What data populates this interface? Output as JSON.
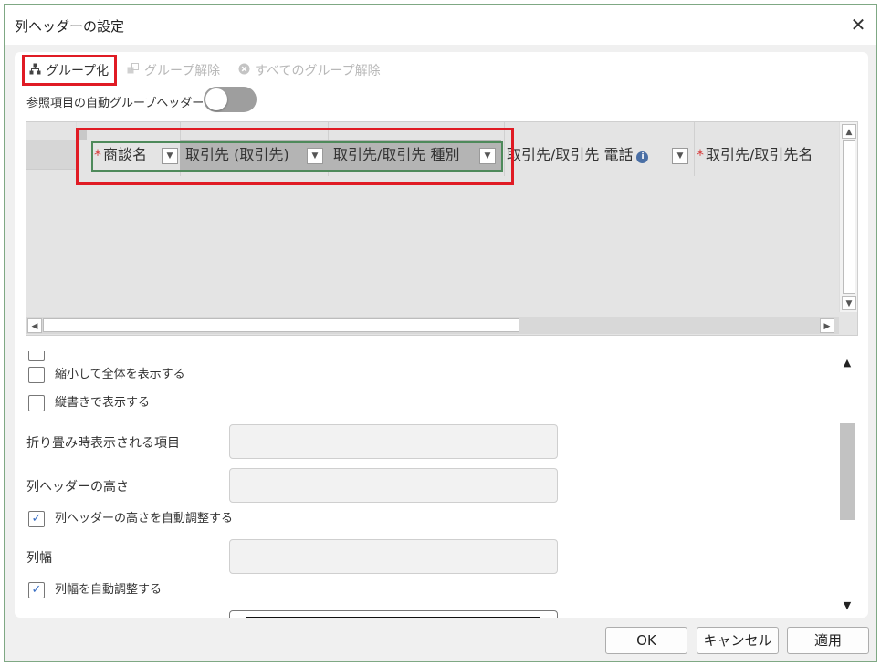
{
  "dialog": {
    "title": "列ヘッダーの設定",
    "close_glyph": "✕"
  },
  "toolbar": {
    "group_label": "グループ化",
    "ungroup_label": "グループ解除",
    "ungroup_all_label": "すべてのグループ解除",
    "group_icon": "hierarchy-icon",
    "ungroup_icon": "ungroup-icon",
    "ungroup_all_icon": "x-circle-icon"
  },
  "auto_group": {
    "label": "参照項目の自動グループヘッダー",
    "enabled": false
  },
  "grid": {
    "columns": [
      {
        "label": "商談名",
        "required": true,
        "grouped": true
      },
      {
        "label": "取引先 (取引先)",
        "required": false,
        "grouped": true
      },
      {
        "label": "取引先/取引先 種別",
        "required": false,
        "grouped": true
      },
      {
        "label": "取引先/取引先 電話",
        "required": false,
        "grouped": false,
        "info": true
      },
      {
        "label": "取引先/取引先名",
        "required": true,
        "grouped": false
      }
    ],
    "required_mark": "*",
    "info_glyph": "i",
    "dropdown_glyph": "▼"
  },
  "props": {
    "shrink_label": "縮小して全体を表示する",
    "shrink_checked": false,
    "vertical_label": "縦書きで表示する",
    "vertical_checked": false,
    "collapsed_item_label": "折り畳み時表示される項目",
    "collapsed_item_value": "",
    "header_height_label": "列ヘッダーの高さ",
    "header_height_value": "",
    "auto_height_label": "列ヘッダーの高さを自動調整する",
    "auto_height_checked": true,
    "col_width_label": "列幅",
    "col_width_value": "",
    "auto_width_label": "列幅を自動調整する",
    "auto_width_checked": true,
    "check_glyph": "✓"
  },
  "footer": {
    "ok_label": "OK",
    "cancel_label": "キャンセル",
    "apply_label": "適用"
  },
  "colors": {
    "highlight": "#e01b24",
    "group_border": "#4e8a5b",
    "required": "#d63a3a",
    "check": "#3a6fc4"
  }
}
